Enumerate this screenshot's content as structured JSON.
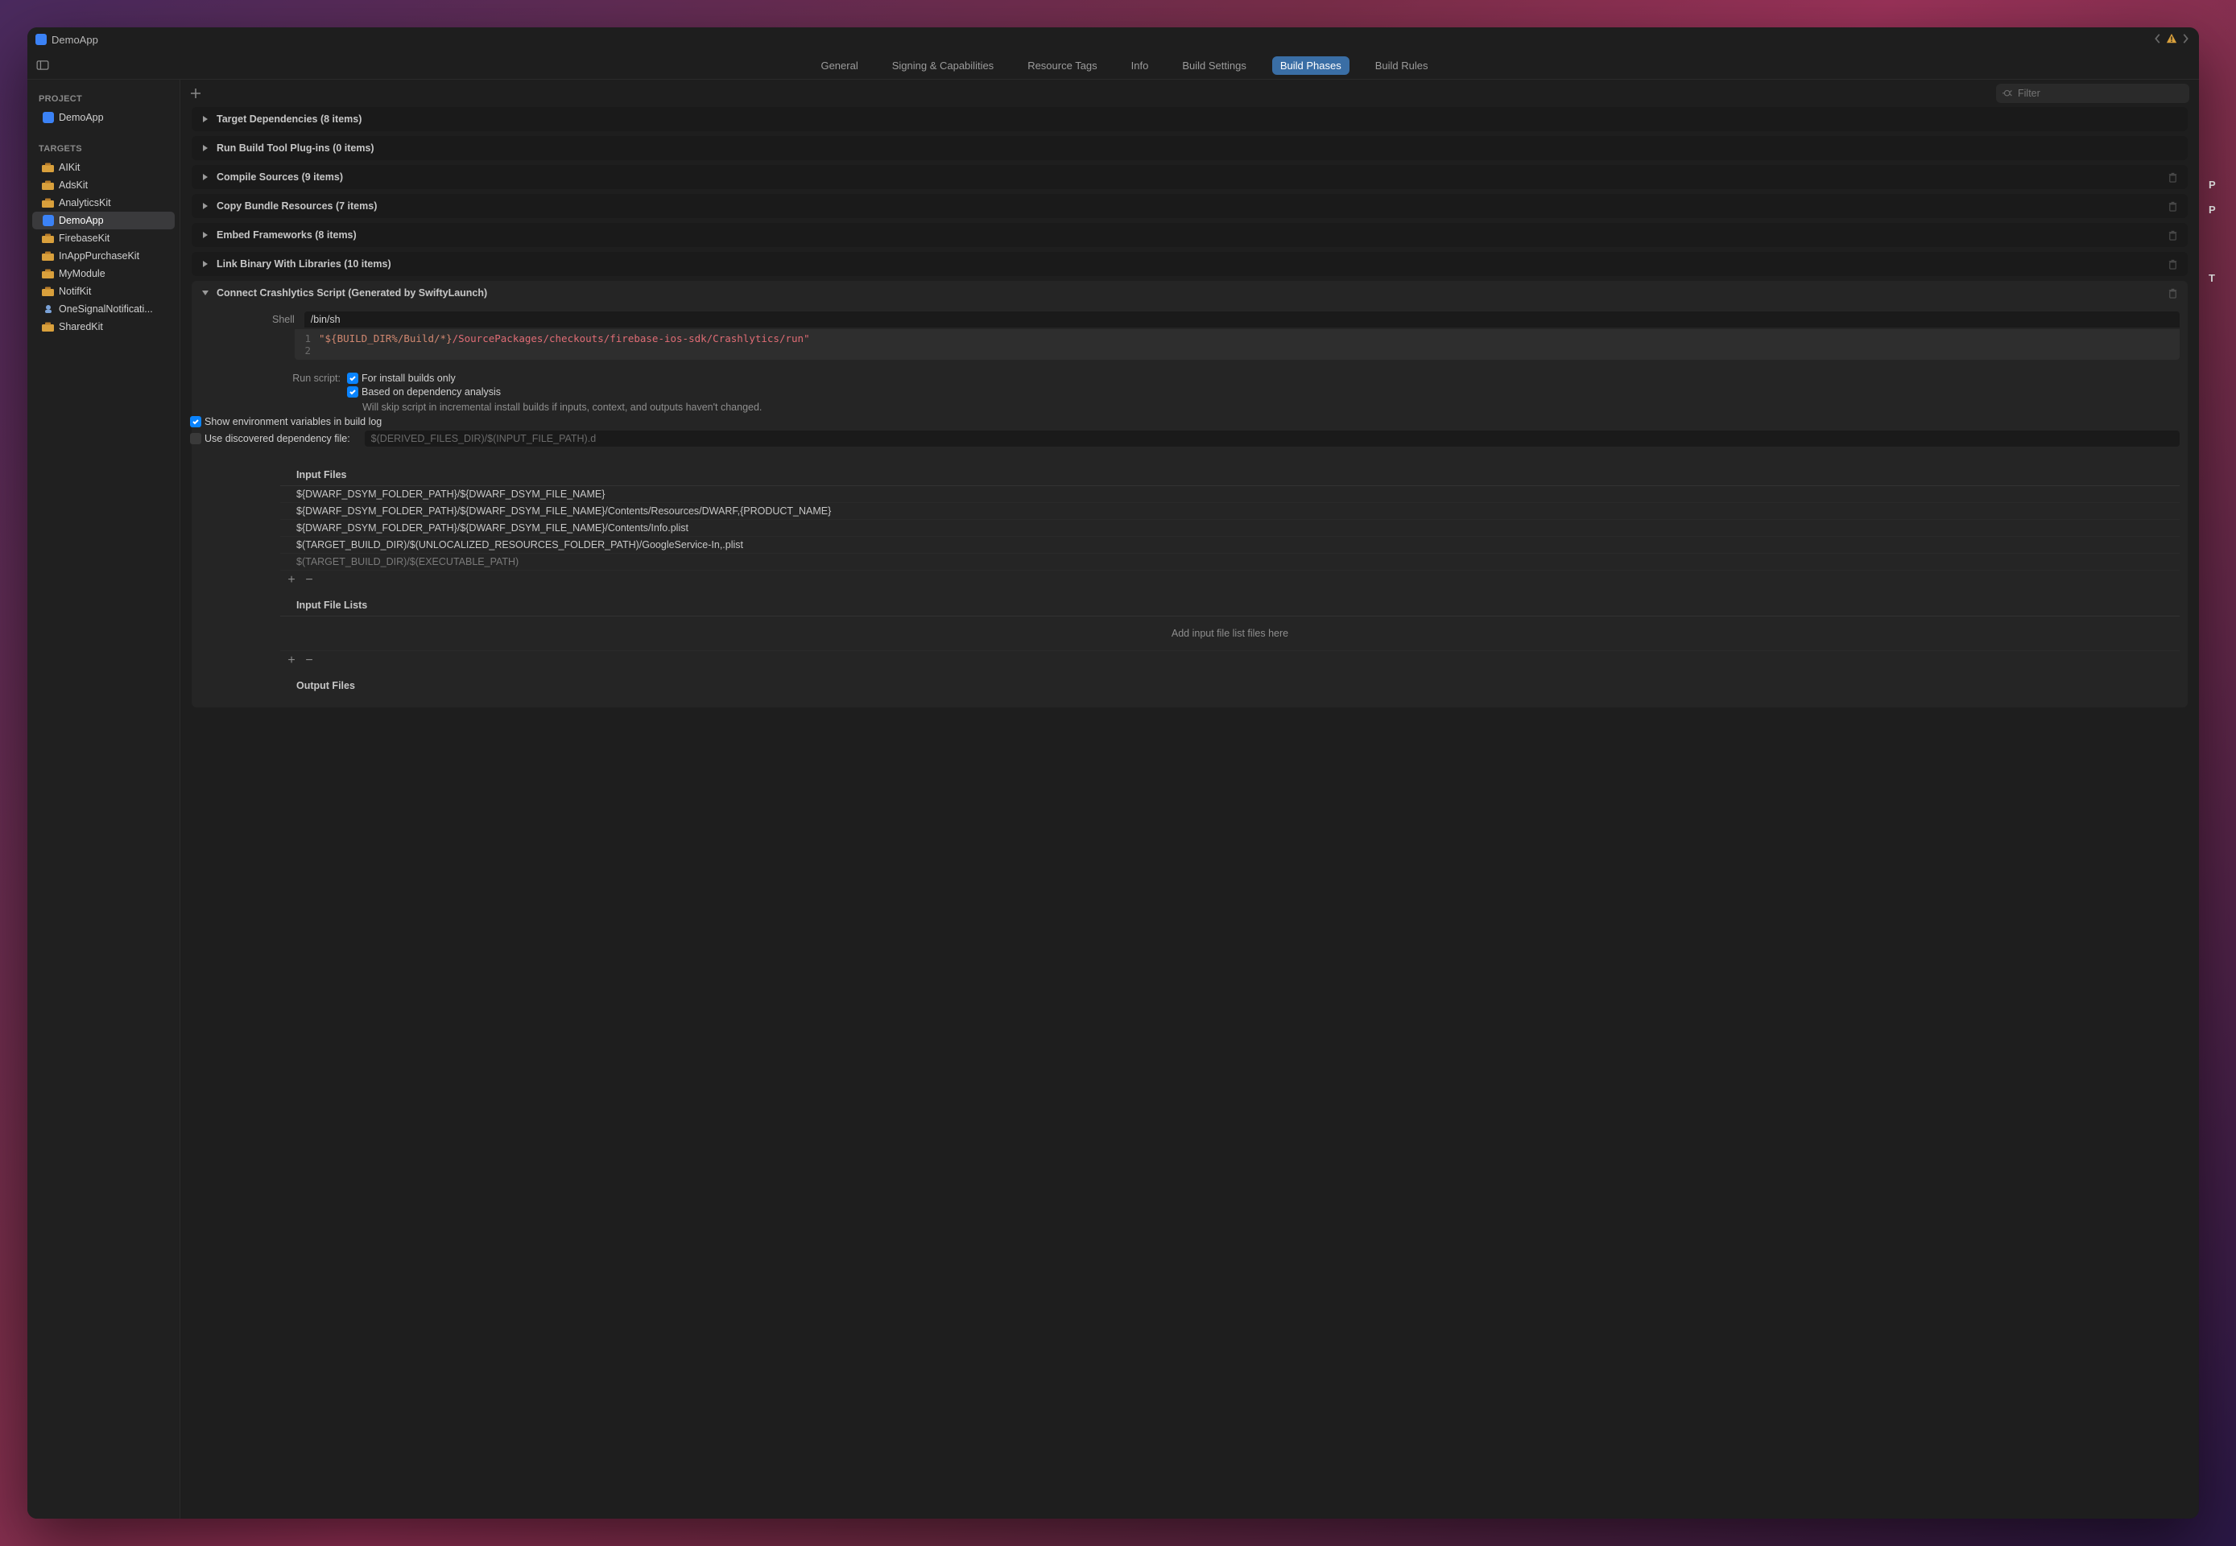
{
  "titlebar": {
    "title": "DemoApp"
  },
  "tabs": {
    "items": [
      "General",
      "Signing & Capabilities",
      "Resource Tags",
      "Info",
      "Build Settings",
      "Build Phases",
      "Build Rules"
    ],
    "activeIndex": 5
  },
  "filter": {
    "placeholder": "Filter"
  },
  "sidebar": {
    "projectHeader": "PROJECT",
    "projects": [
      {
        "label": "DemoApp"
      }
    ],
    "targetsHeader": "TARGETS",
    "targets": [
      {
        "label": "AIKit",
        "icon": "toolbox"
      },
      {
        "label": "AdsKit",
        "icon": "toolbox"
      },
      {
        "label": "AnalyticsKit",
        "icon": "toolbox"
      },
      {
        "label": "DemoApp",
        "icon": "app",
        "selected": true
      },
      {
        "label": "FirebaseKit",
        "icon": "toolbox"
      },
      {
        "label": "InAppPurchaseKit",
        "icon": "toolbox"
      },
      {
        "label": "MyModule",
        "icon": "toolbox"
      },
      {
        "label": "NotifKit",
        "icon": "toolbox"
      },
      {
        "label": "OneSignalNotificati...",
        "icon": "extension"
      },
      {
        "label": "SharedKit",
        "icon": "toolbox"
      }
    ]
  },
  "phases": {
    "collapsed": [
      {
        "label": "Target Dependencies (8 items)",
        "trash": false
      },
      {
        "label": "Run Build Tool Plug-ins (0 items)",
        "trash": false
      },
      {
        "label": "Compile Sources (9 items)",
        "trash": true
      },
      {
        "label": "Copy Bundle Resources (7 items)",
        "trash": true
      },
      {
        "label": "Embed Frameworks (8 items)",
        "trash": true
      },
      {
        "label": "Link Binary With Libraries (10 items)",
        "trash": true
      }
    ],
    "expanded": {
      "label": "Connect Crashlytics Script (Generated by SwiftyLaunch)",
      "shellLabel": "Shell",
      "shellValue": "/bin/sh",
      "code": {
        "line1_prefix": "\"${BUILD_DIR%/Build/*}",
        "line1_suffix": "/SourcePackages/checkouts/firebase-ios-sdk/Crashlytics/run\""
      },
      "runScriptLabel": "Run script:",
      "opts": {
        "installOnly": "For install builds only",
        "depAnalysis": "Based on dependency analysis",
        "depNote": "Will skip script in incremental install builds if inputs, context, and outputs haven't changed.",
        "showEnv": "Show environment variables in build log",
        "useDepFile": "Use discovered dependency file:",
        "depPlaceholder": "$(DERIVED_FILES_DIR)/$(INPUT_FILE_PATH).d"
      },
      "inputFiles": {
        "header": "Input Files",
        "rows": [
          "${DWARF_DSYM_FOLDER_PATH}/${DWARF_DSYM_FILE_NAME}",
          "${DWARF_DSYM_FOLDER_PATH}/${DWARF_DSYM_FILE_NAME}/Contents/Resources/DWARF,{PRODUCT_NAME}",
          "${DWARF_DSYM_FOLDER_PATH}/${DWARF_DSYM_FILE_NAME}/Contents/Info.plist",
          "$(TARGET_BUILD_DIR)/$(UNLOCALIZED_RESOURCES_FOLDER_PATH)/GoogleService-In,.plist",
          "$(TARGET_BUILD_DIR)/$(EXECUTABLE_PATH)"
        ]
      },
      "inputFileLists": {
        "header": "Input File Lists",
        "placeholder": "Add input file list files here"
      },
      "outputFiles": {
        "header": "Output Files"
      }
    }
  },
  "rightStrip": {
    "a": "P",
    "b": "P",
    "c": "T"
  }
}
